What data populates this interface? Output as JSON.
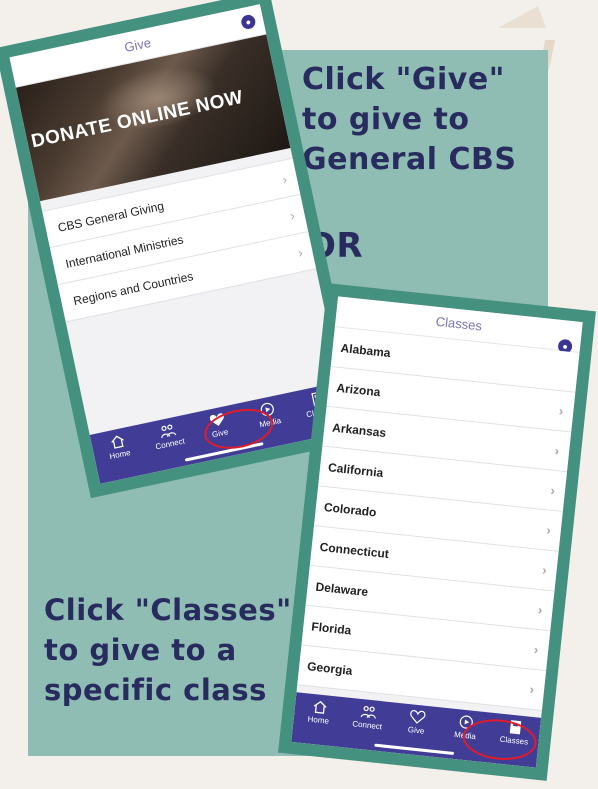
{
  "instructions": {
    "give_heading": "Click \"Give\"\nto give to\nGeneral CBS",
    "or_text": "OR",
    "classes_heading": "Click \"Classes\"\nto give to a\nspecific class"
  },
  "phone_give": {
    "header_title": "Give",
    "banner_text": "DONATE ONLINE NOW",
    "rows": [
      "CBS General Giving",
      "International Ministries",
      "Regions and Countries"
    ],
    "tabs": [
      {
        "label": "Home",
        "icon": "home-icon"
      },
      {
        "label": "Connect",
        "icon": "people-icon"
      },
      {
        "label": "Give",
        "icon": "heart-icon"
      },
      {
        "label": "Media",
        "icon": "play-icon"
      },
      {
        "label": "Classes",
        "icon": "book-icon"
      }
    ]
  },
  "phone_classes": {
    "header_title": "Classes",
    "rows": [
      "Alabama",
      "Arizona",
      "Arkansas",
      "California",
      "Colorado",
      "Connecticut",
      "Delaware",
      "Florida",
      "Georgia"
    ],
    "tabs": [
      {
        "label": "Home",
        "icon": "home-icon"
      },
      {
        "label": "Connect",
        "icon": "people-icon"
      },
      {
        "label": "Give",
        "icon": "heart-icon"
      },
      {
        "label": "Media",
        "icon": "play-icon"
      },
      {
        "label": "Classes",
        "icon": "book-icon"
      }
    ]
  },
  "colors": {
    "panel": "#8fbcb3",
    "frame": "#45917f",
    "heading": "#272b5e",
    "tabbar": "#413c96",
    "highlight": "#e21b2a"
  }
}
